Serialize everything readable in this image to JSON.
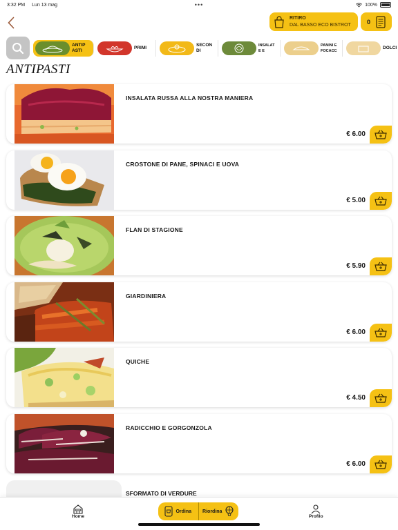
{
  "status_bar": {
    "time": "3:32 PM",
    "date": "Lun 13 mag",
    "dots": "•••",
    "battery": "100%"
  },
  "header": {
    "pickup_title": "RITIRO",
    "pickup_location": "DAL BASSO ECO BISTROT",
    "cart_count": "0"
  },
  "categories": [
    {
      "label": "ANTIP\nASTI",
      "label_a": "ANTIP",
      "label_b": "ASTI",
      "color": "#6b8e2c"
    },
    {
      "label_a": "PRIMI",
      "label_b": "",
      "color": "#d2362b"
    },
    {
      "label_a": "SECON",
      "label_b": "DI",
      "color": "#f2b918"
    },
    {
      "label_a": "INSALAT",
      "label_b": "E E",
      "color": "#6d8a3a"
    },
    {
      "label_a": "PANINI E",
      "label_b": "FOCACC",
      "color": "#eccf8c"
    },
    {
      "label_a": "DOLCI",
      "label_b": "",
      "color": "#f0d7a0"
    }
  ],
  "section_title": "ANTIPASTI",
  "items": [
    {
      "name": "INSALATA RUSSA ALLA NOSTRA MANIERA",
      "price": "€ 6.00"
    },
    {
      "name": "CROSTONE DI PANE, SPINACI E UOVA",
      "price": "€ 5.00"
    },
    {
      "name": "FLAN DI STAGIONE",
      "price": "€ 5.90"
    },
    {
      "name": "GIARDINIERA",
      "price": "€ 6.00"
    },
    {
      "name": "QUICHE",
      "price": "€ 4.50"
    },
    {
      "name": "RADICCHIO E GORGONZOLA",
      "price": "€ 6.00"
    }
  ],
  "partial_item": {
    "name": "SFORMATO DI VERDURE"
  },
  "tab_bar": {
    "home": "Home",
    "order": "Ordina",
    "reorder": "Riordina",
    "profile": "Profilo"
  },
  "colors": {
    "accent": "#f5c114",
    "search_bg": "#c4c4c4"
  }
}
